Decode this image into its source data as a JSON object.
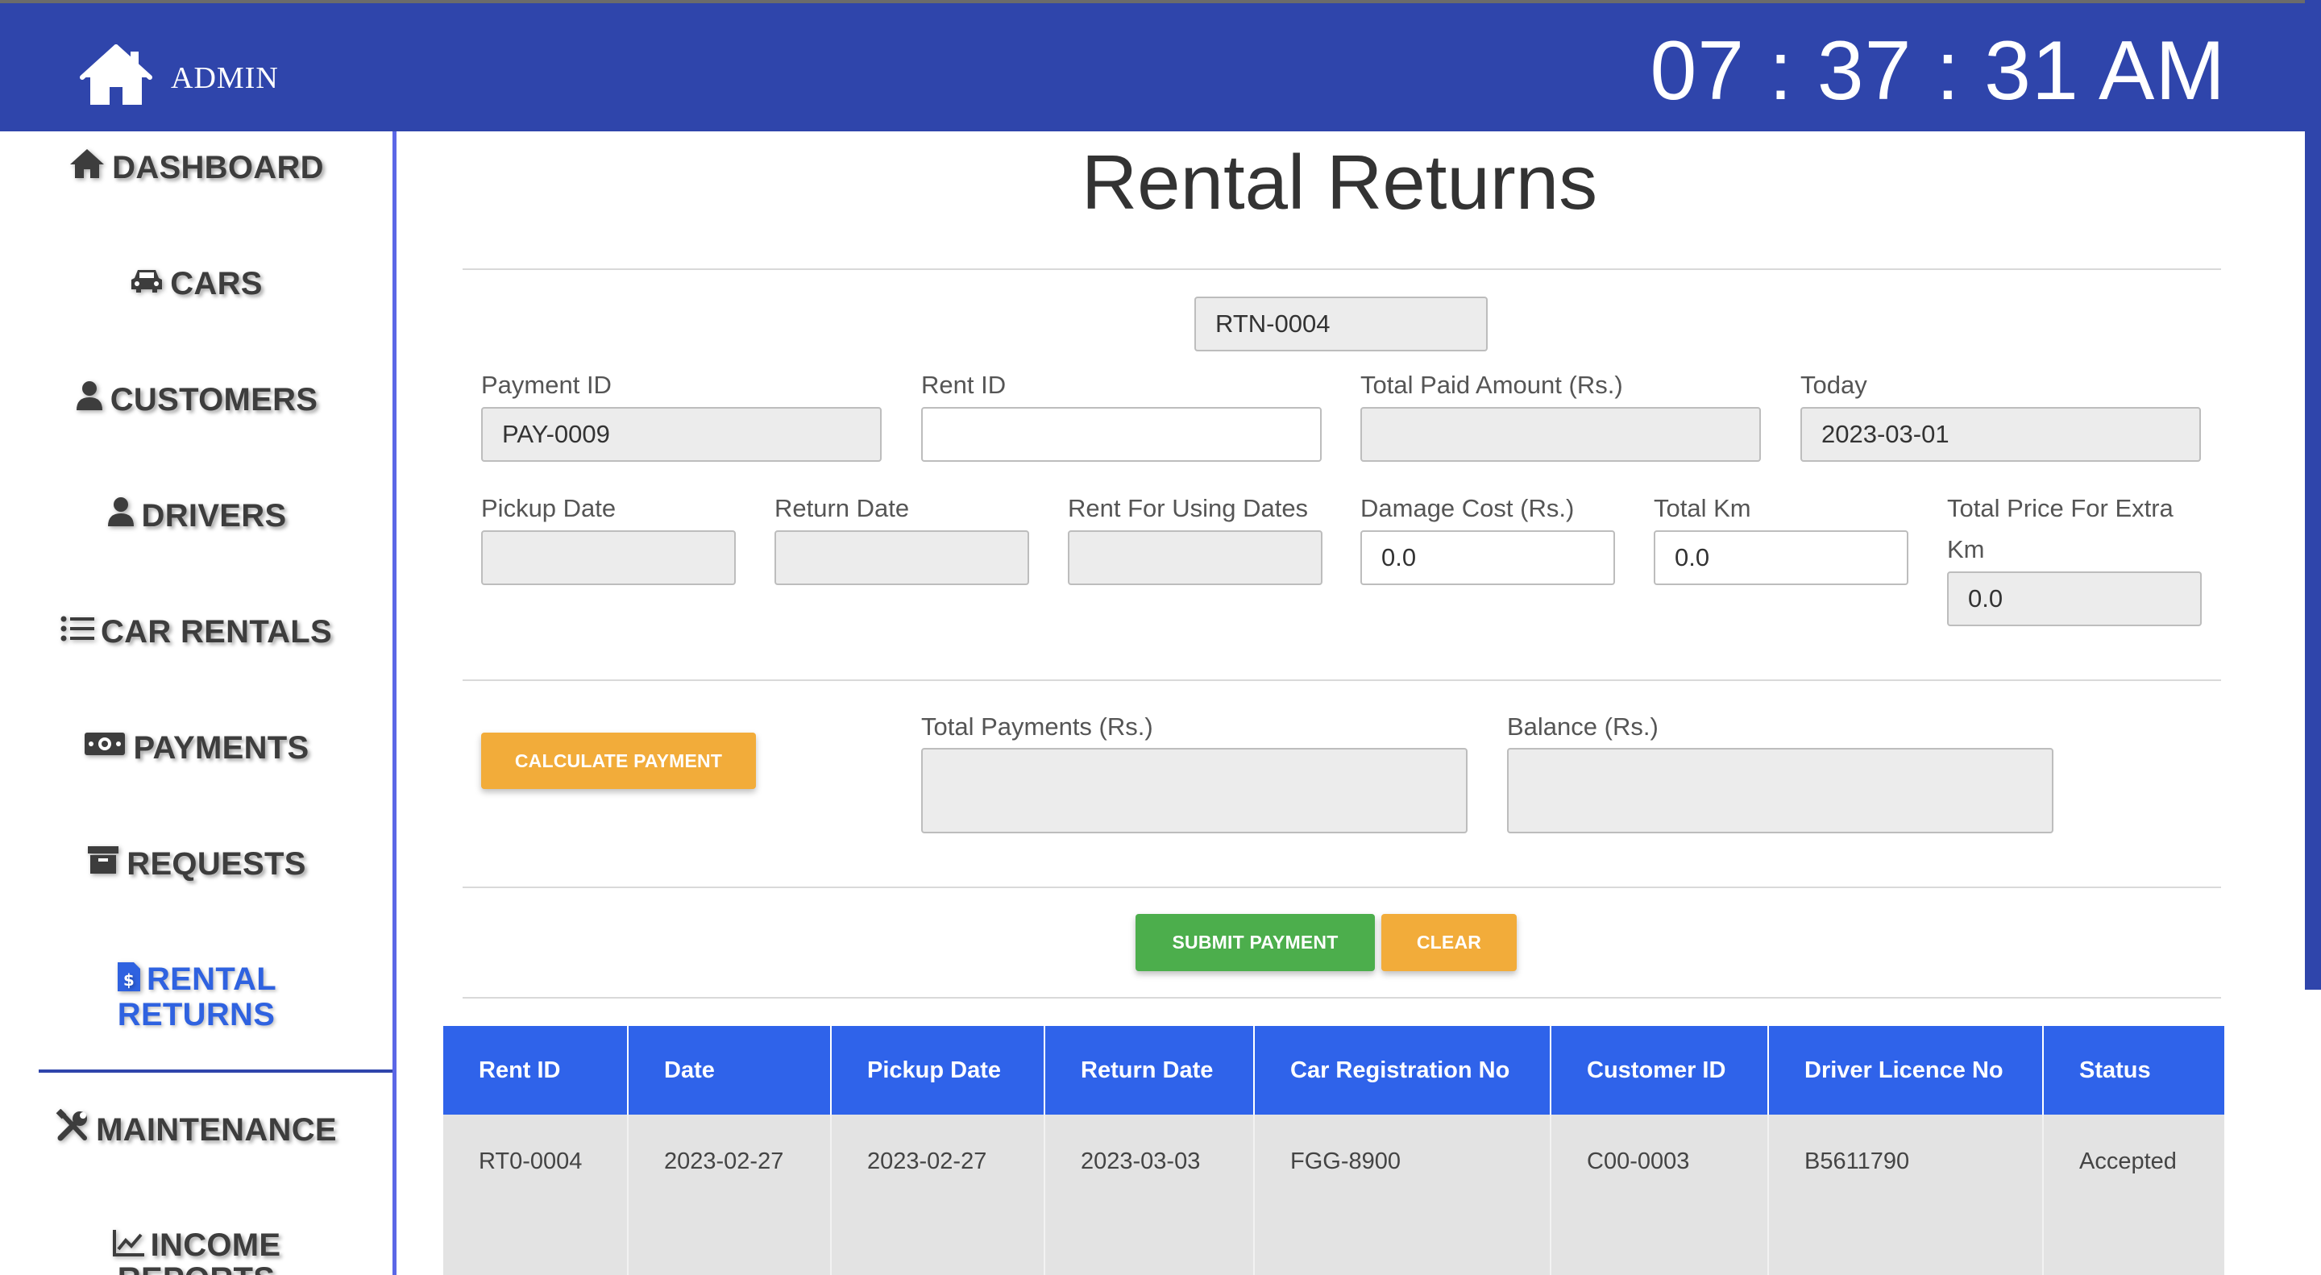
{
  "header": {
    "brand_label": "ADMIN",
    "clock": "07 : 37 : 31 AM",
    "bar_color": "#2f45ab"
  },
  "sidebar": {
    "items": [
      {
        "label": "DASHBOARD",
        "icon": "home-icon"
      },
      {
        "label": "CARS",
        "icon": "car-icon"
      },
      {
        "label": "CUSTOMERS",
        "icon": "user-icon"
      },
      {
        "label": "DRIVERS",
        "icon": "user-icon"
      },
      {
        "label": "CAR RENTALS",
        "icon": "list-icon"
      },
      {
        "label": "PAYMENTS",
        "icon": "money-icon"
      },
      {
        "label": "REQUESTS",
        "icon": "archive-icon"
      },
      {
        "label_line1": "RENTAL",
        "label_line2": "RETURNS",
        "icon": "invoice-icon",
        "active": true
      },
      {
        "label": "MAINTENANCE",
        "icon": "tools-icon"
      },
      {
        "label_line1": "INCOME",
        "label_line2": "REPORTS",
        "icon": "chart-line-icon"
      }
    ],
    "active_color": "#2f62e0"
  },
  "main": {
    "title": "Rental Returns",
    "return_id": "RTN-0004",
    "fields": {
      "payment_id": {
        "label": "Payment ID",
        "value": "PAY-0009"
      },
      "rent_id": {
        "label": "Rent ID",
        "value": ""
      },
      "total_paid": {
        "label": "Total Paid Amount (Rs.)",
        "value": ""
      },
      "today": {
        "label": "Today",
        "value": "2023-03-01"
      },
      "pickup_date": {
        "label": "Pickup Date",
        "value": ""
      },
      "return_date": {
        "label": "Return Date",
        "value": ""
      },
      "rent_using_dates": {
        "label": "Rent For Using Dates",
        "value": ""
      },
      "damage_cost": {
        "label": "Damage Cost (Rs.)",
        "value": "0.0"
      },
      "total_km": {
        "label": "Total Km",
        "value": "0.0"
      },
      "extra_km_price": {
        "label_line1": "Total Price For Extra",
        "label_line2": "Km",
        "value": "0.0"
      },
      "total_payments": {
        "label": "Total Payments (Rs.)",
        "value": ""
      },
      "balance": {
        "label": "Balance (Rs.)",
        "value": ""
      }
    },
    "buttons": {
      "calculate": "CALCULATE PAYMENT",
      "submit": "SUBMIT PAYMENT",
      "clear": "CLEAR"
    },
    "colors": {
      "orange": "#f2ac3a",
      "green": "#4cae4c",
      "table_header": "#2f63ea"
    }
  },
  "table": {
    "columns": [
      "Rent ID",
      "Date",
      "Pickup Date",
      "Return Date",
      "Car Registration No",
      "Customer ID",
      "Driver Licence No",
      "Status"
    ],
    "rows": [
      [
        "RT0-0004",
        "2023-02-27",
        "2023-02-27",
        "2023-03-03",
        "FGG-8900",
        "C00-0003",
        "B5611790",
        "Accepted"
      ]
    ]
  }
}
